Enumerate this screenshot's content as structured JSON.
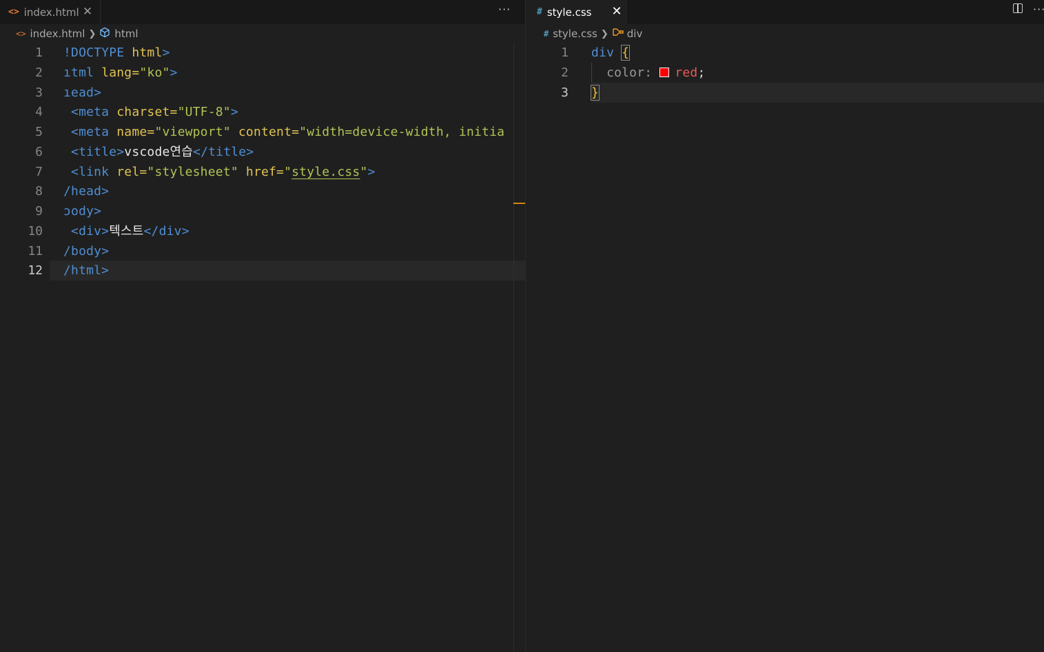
{
  "left_editor": {
    "tab": {
      "icon": "<>",
      "label": "index.html",
      "close": "✕"
    },
    "more_actions": "···",
    "breadcrumb": {
      "file_icon": "<>",
      "file": "index.html",
      "symbol": "html"
    },
    "lines": [
      {
        "num": "1",
        "tokens": [
          {
            "c": "t-doc",
            "t": "!DOCTYPE "
          },
          {
            "c": "t-kw",
            "t": "html"
          },
          {
            "c": "t-tag",
            "t": ">"
          }
        ]
      },
      {
        "num": "2",
        "tokens": [
          {
            "c": "t-tag",
            "t": "ıtml "
          },
          {
            "c": "t-attr",
            "t": "lang="
          },
          {
            "c": "t-str",
            "t": "\"ko\""
          },
          {
            "c": "t-tag",
            "t": ">"
          }
        ]
      },
      {
        "num": "3",
        "tokens": [
          {
            "c": "t-tag",
            "t": "ıead>"
          }
        ]
      },
      {
        "num": "4",
        "tokens": [
          {
            "c": "t-tag",
            "t": " <meta "
          },
          {
            "c": "t-attr",
            "t": "charset="
          },
          {
            "c": "t-str",
            "t": "\"UTF-8\""
          },
          {
            "c": "t-tag",
            "t": ">"
          }
        ]
      },
      {
        "num": "5",
        "tokens": [
          {
            "c": "t-tag",
            "t": " <meta "
          },
          {
            "c": "t-attr",
            "t": "name="
          },
          {
            "c": "t-str",
            "t": "\"viewport\" "
          },
          {
            "c": "t-attr",
            "t": "content="
          },
          {
            "c": "t-str",
            "t": "\"width=device-width, initia"
          }
        ]
      },
      {
        "num": "6",
        "tokens": [
          {
            "c": "t-tag",
            "t": " <title>"
          },
          {
            "c": "t-text",
            "t": "vscode연습"
          },
          {
            "c": "t-tag",
            "t": "</title>"
          }
        ]
      },
      {
        "num": "7",
        "tokens": [
          {
            "c": "t-tag",
            "t": " <link "
          },
          {
            "c": "t-attr",
            "t": "rel="
          },
          {
            "c": "t-str",
            "t": "\"stylesheet\" "
          },
          {
            "c": "t-attr",
            "t": "href="
          },
          {
            "c": "t-str",
            "t": "\""
          },
          {
            "c": "t-str link-underline",
            "t": "style.css"
          },
          {
            "c": "t-str",
            "t": "\""
          },
          {
            "c": "t-tag",
            "t": ">"
          }
        ]
      },
      {
        "num": "8",
        "tokens": [
          {
            "c": "t-tag",
            "t": "/head>"
          }
        ]
      },
      {
        "num": "9",
        "tokens": [
          {
            "c": "t-tag",
            "t": "ɔody>"
          }
        ]
      },
      {
        "num": "10",
        "tokens": [
          {
            "c": "t-tag",
            "t": " <div>"
          },
          {
            "c": "t-text",
            "t": "텍스트"
          },
          {
            "c": "t-tag",
            "t": "</div>"
          }
        ]
      },
      {
        "num": "11",
        "tokens": [
          {
            "c": "t-tag",
            "t": "/body>"
          }
        ]
      },
      {
        "num": "12",
        "tokens": [
          {
            "c": "t-tag",
            "t": "/html>"
          }
        ]
      }
    ]
  },
  "right_editor": {
    "tab": {
      "icon": "#",
      "label": "style.css",
      "close": "✕"
    },
    "more_actions": "···",
    "breadcrumb": {
      "file_icon": "#",
      "file": "style.css",
      "symbol_icon": "⛓",
      "symbol": "div"
    },
    "lines": [
      {
        "num": "1",
        "tokens": [
          {
            "c": "t-sel",
            "t": "div "
          },
          {
            "c": "t-brace brace-box",
            "t": "{"
          }
        ]
      },
      {
        "num": "2",
        "tokens": [
          {
            "c": "t-prop",
            "t": "  color: "
          },
          {
            "c": "swatch",
            "t": ""
          },
          {
            "c": "t-val",
            "t": "red"
          },
          {
            "c": "t-semi",
            "t": ";"
          }
        ]
      },
      {
        "num": "3",
        "tokens": [
          {
            "c": "t-brace brace-box",
            "t": "}"
          }
        ]
      }
    ],
    "swatch_color": "#ff0000"
  }
}
